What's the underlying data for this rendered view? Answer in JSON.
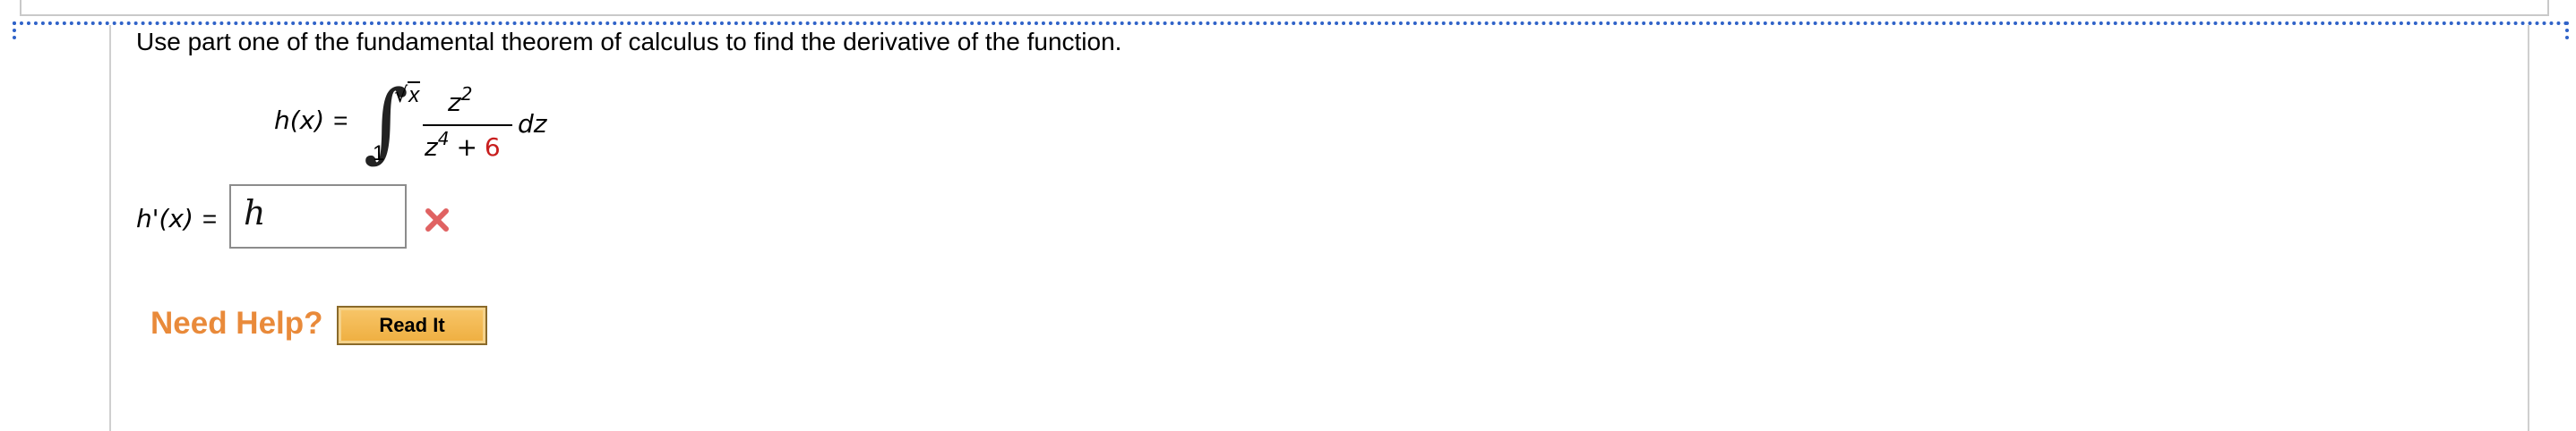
{
  "question": {
    "text": "Use part one of the fundamental theorem of calculus to find the derivative of the function."
  },
  "equation": {
    "lhs": "h(x)",
    "equals": "=",
    "integral_sign": "∫",
    "upper_limit_radical": "√",
    "upper_limit_radicand": "x",
    "lower_limit": "1",
    "numerator_base": "z",
    "numerator_exp": "2",
    "denominator_base": "z",
    "denominator_exp": "4",
    "denominator_plus": "+",
    "denominator_const": "6",
    "differential": "dz",
    "const_color": "#c81e1e"
  },
  "answer": {
    "label": "h'(x)",
    "equals": "=",
    "input_value": "h",
    "status_icon": "wrong-x-icon",
    "status_color": "#e06262"
  },
  "help": {
    "label": "Need Help?",
    "read_button_label": "Read It",
    "label_color": "#e98a3a"
  }
}
